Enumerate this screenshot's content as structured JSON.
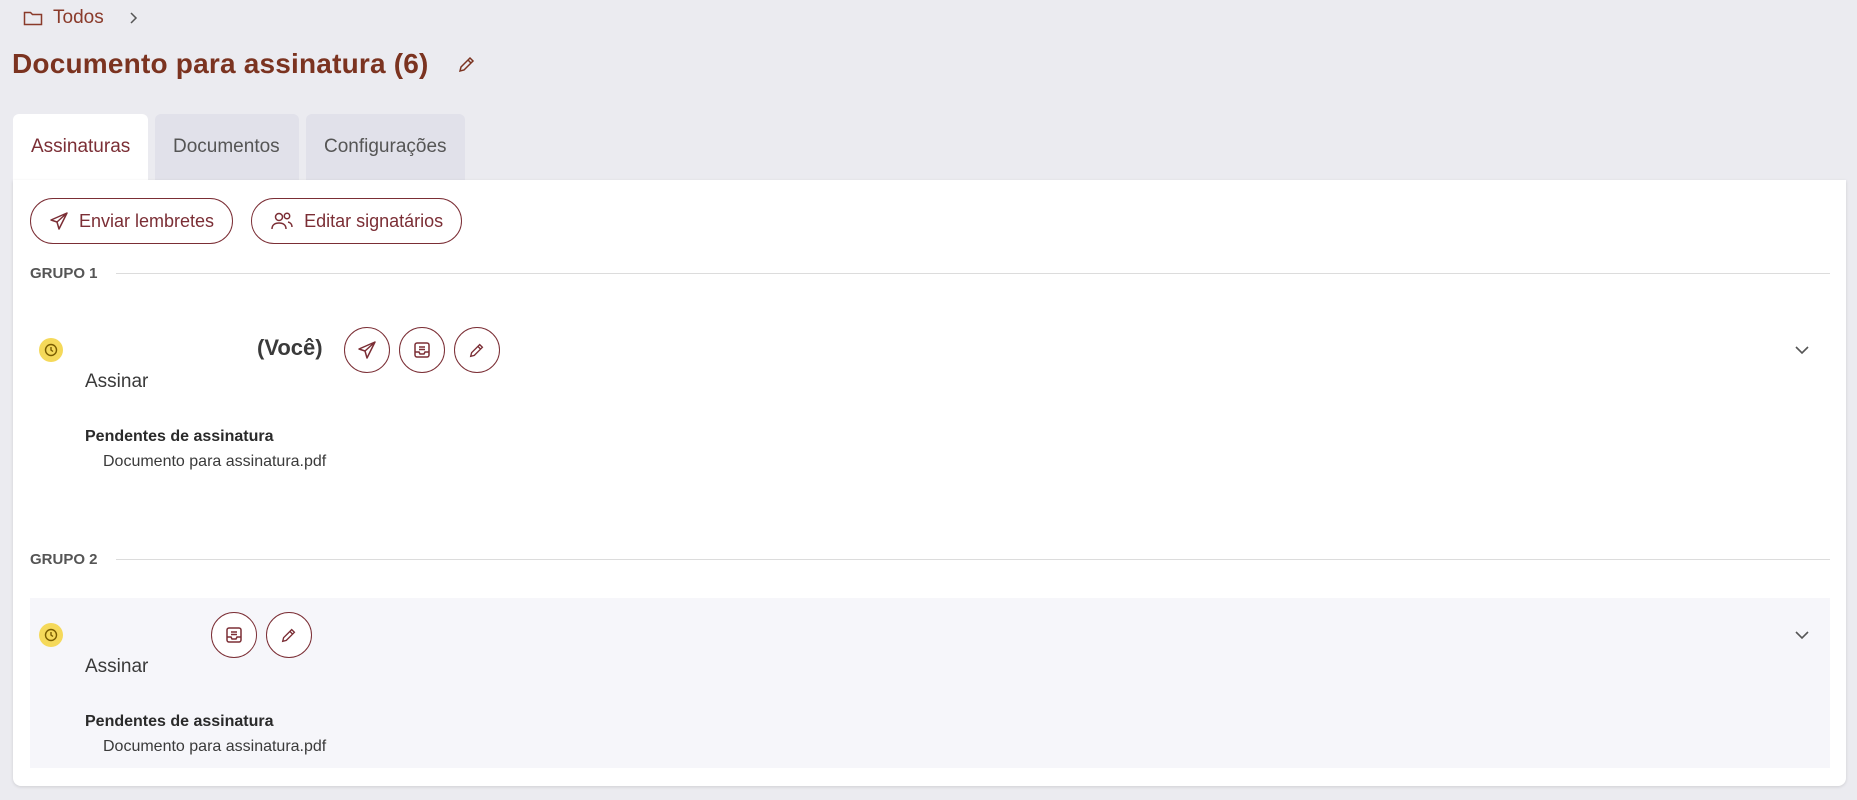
{
  "breadcrumb": {
    "root_label": "Todos",
    "separator": "›"
  },
  "page": {
    "title": "Documento para assinatura (6)"
  },
  "tabs": [
    {
      "label": "Assinaturas",
      "active": true
    },
    {
      "label": "Documentos",
      "active": false
    },
    {
      "label": "Configurações",
      "active": false
    }
  ],
  "actions": {
    "send_reminders": "Enviar lembretes",
    "edit_signers": "Editar signatários"
  },
  "groups": [
    {
      "label": "GRUPO 1",
      "signer": {
        "you_label": "(Você)",
        "status_icon": "clock-icon",
        "action": "Assinar",
        "pending_title": "Pendentes de assinatura",
        "pending_document": "Documento para assinatura.pdf"
      }
    },
    {
      "label": "GRUPO 2",
      "signer": {
        "status_icon": "clock-icon",
        "action": "Assinar",
        "pending_title": "Pendentes de assinatura",
        "pending_document": "Documento para assinatura.pdf"
      }
    }
  ],
  "colors": {
    "accent": "#7b2e35",
    "title": "#7b3320",
    "background": "#ebebf0",
    "status_pending": "#f5d95a"
  }
}
